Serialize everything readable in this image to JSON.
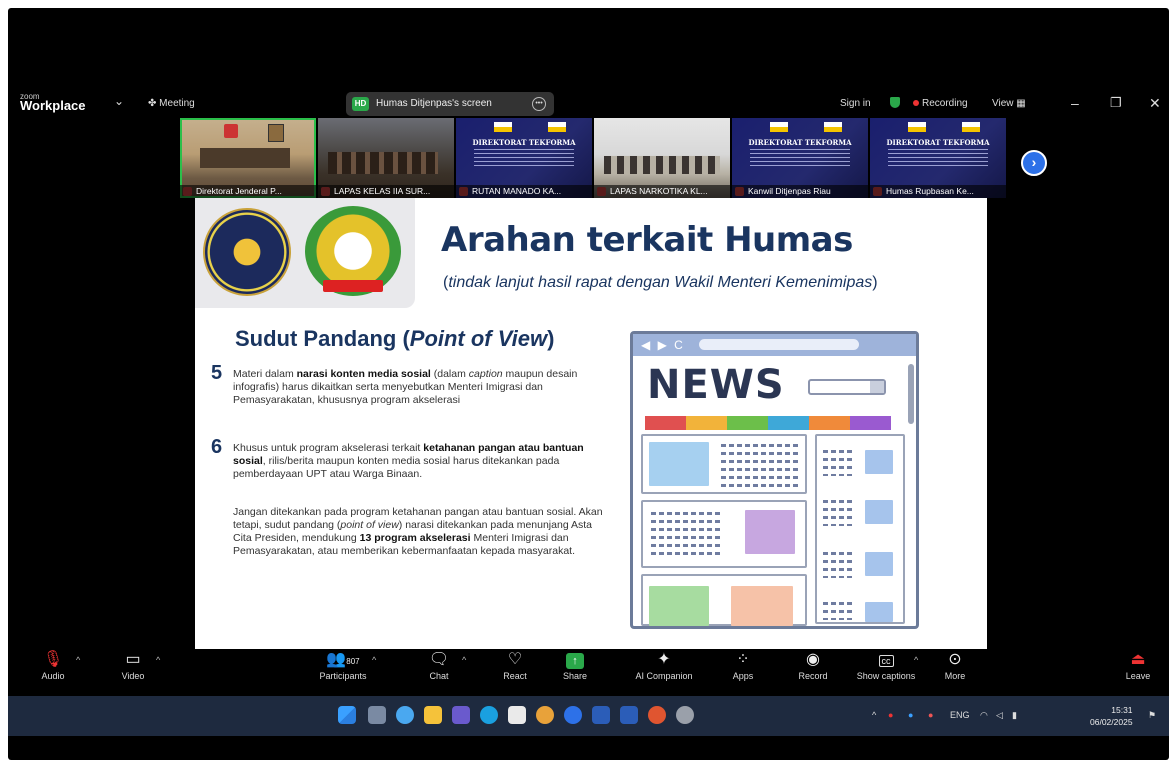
{
  "zoom": {
    "logo_small": "zoom",
    "logo_big": "Workplace",
    "chevron": "⌄",
    "meeting_label": "Meeting",
    "share_badge": "HD",
    "share_label": "Humas Ditjenpas's screen",
    "signin": "Sign in",
    "recording": "Recording",
    "view": "View"
  },
  "thumbnails": [
    {
      "label": "Direktorat Jenderal P..."
    },
    {
      "label": "LAPAS KELAS IIA SUR..."
    },
    {
      "label": "RUTAN MANADO KA..."
    },
    {
      "label": "LAPAS NARKOTIKA KL..."
    },
    {
      "label": "Kanwil Ditjenpas Riau"
    },
    {
      "label": "Humas Rupbasan Ke..."
    }
  ],
  "banner_text": "DIREKTORAT TEKFORMA",
  "slide": {
    "title": "Arahan terkait Humas",
    "subtitle_open": "(",
    "subtitle": "tindak lanjut hasil rapat dengan Wakil Menteri Kemenimipas",
    "subtitle_close": ")",
    "section_title": "Sudut Pandang (",
    "section_title_em": "Point of View",
    "section_title_close": ")",
    "item5_num": "5",
    "item5_a": "Materi dalam ",
    "item5_b": "narasi konten media sosial",
    "item5_c": " (dalam ",
    "item5_d": "caption",
    "item5_e": " maupun desain infografis) harus dikaitkan serta menyebutkan Menteri Imigrasi dan Pemasyarakatan, khususnya program akselerasi",
    "item6_num": "6",
    "item6_a": "Khusus untuk program akselerasi terkait ",
    "item6_b": "ketahanan pangan atau bantuan sosial",
    "item6_c": ", rilis/berita maupun konten media sosial harus ditekankan pada pemberdayaan UPT atau Warga Binaan.",
    "para2_a": "Jangan ditekankan pada program ketahanan pangan atau bantuan sosial. Akan tetapi, sudut pandang (",
    "para2_b": "point of view",
    "para2_c": ") narasi ditekankan pada menunjang Asta Cita Presiden, mendukung ",
    "para2_d": "13 program akselerasi",
    "para2_e": " Menteri Imigrasi dan Pemasyarakatan, atau memberikan kebermanfaatan kepada masyarakat.",
    "news_headline": "NEWS",
    "news_nav": "◀ ▶ C"
  },
  "toolbar": {
    "audio": "Audio",
    "video": "Video",
    "participants_count": "807",
    "participants": "Participants",
    "chat": "Chat",
    "react": "React",
    "share": "Share",
    "ai": "AI Companion",
    "apps": "Apps",
    "record": "Record",
    "captions": "Show captions",
    "more": "More",
    "leave": "Leave"
  },
  "taskbar": {
    "lang": "ENG",
    "time": "15:31",
    "date": "06/02/2025"
  },
  "colors": {
    "accent_green": "#2bbf4a",
    "slide_navy": "#1a3560",
    "record_red": "#e33333",
    "zoom_blue": "#2d71e8"
  }
}
